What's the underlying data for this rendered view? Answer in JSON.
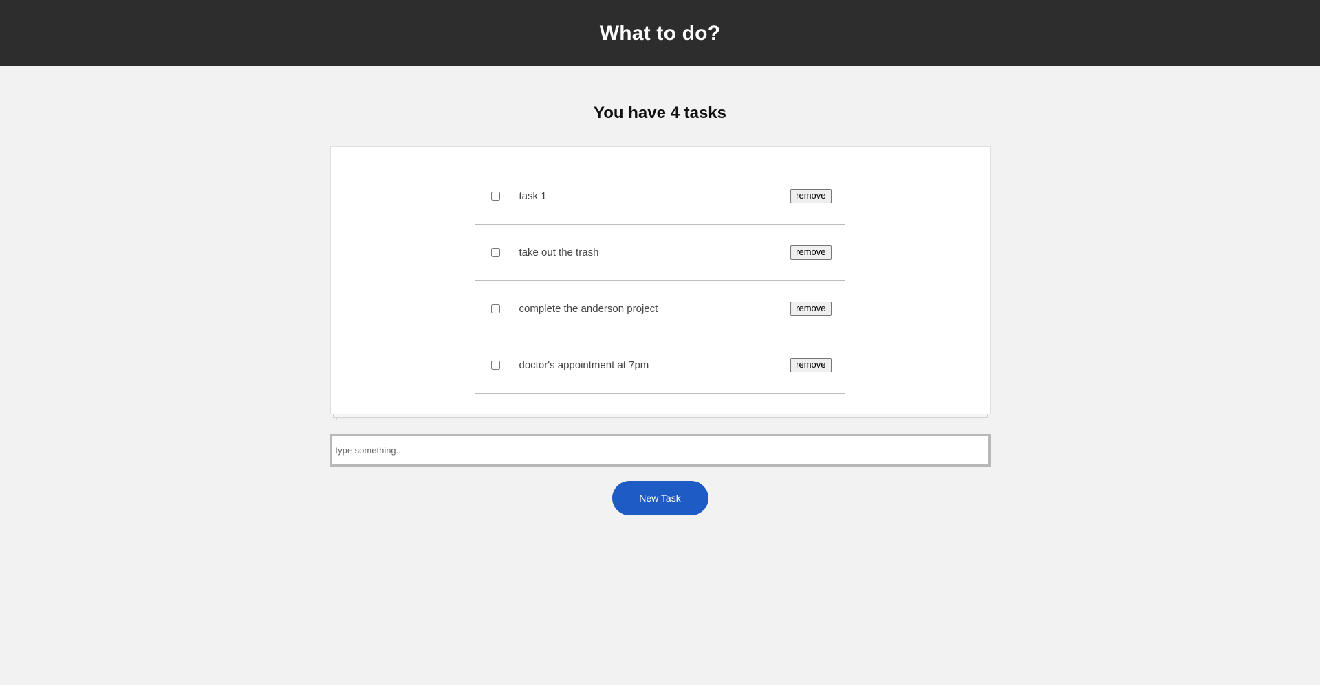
{
  "header": {
    "title": "What to do?"
  },
  "summary": {
    "count_text": "You have 4 tasks"
  },
  "tasks": [
    {
      "label": "task 1",
      "remove_label": "remove",
      "done": false
    },
    {
      "label": "take out the trash",
      "remove_label": "remove",
      "done": false
    },
    {
      "label": "complete the anderson project",
      "remove_label": "remove",
      "done": false
    },
    {
      "label": "doctor's appointment at 7pm",
      "remove_label": "remove",
      "done": false
    }
  ],
  "entry": {
    "placeholder": "type something...",
    "value": ""
  },
  "actions": {
    "new_task_label": "New Task"
  },
  "colors": {
    "header_bg": "#2d2d2d",
    "page_bg": "#f2f2f2",
    "accent": "#1f5bc5"
  }
}
